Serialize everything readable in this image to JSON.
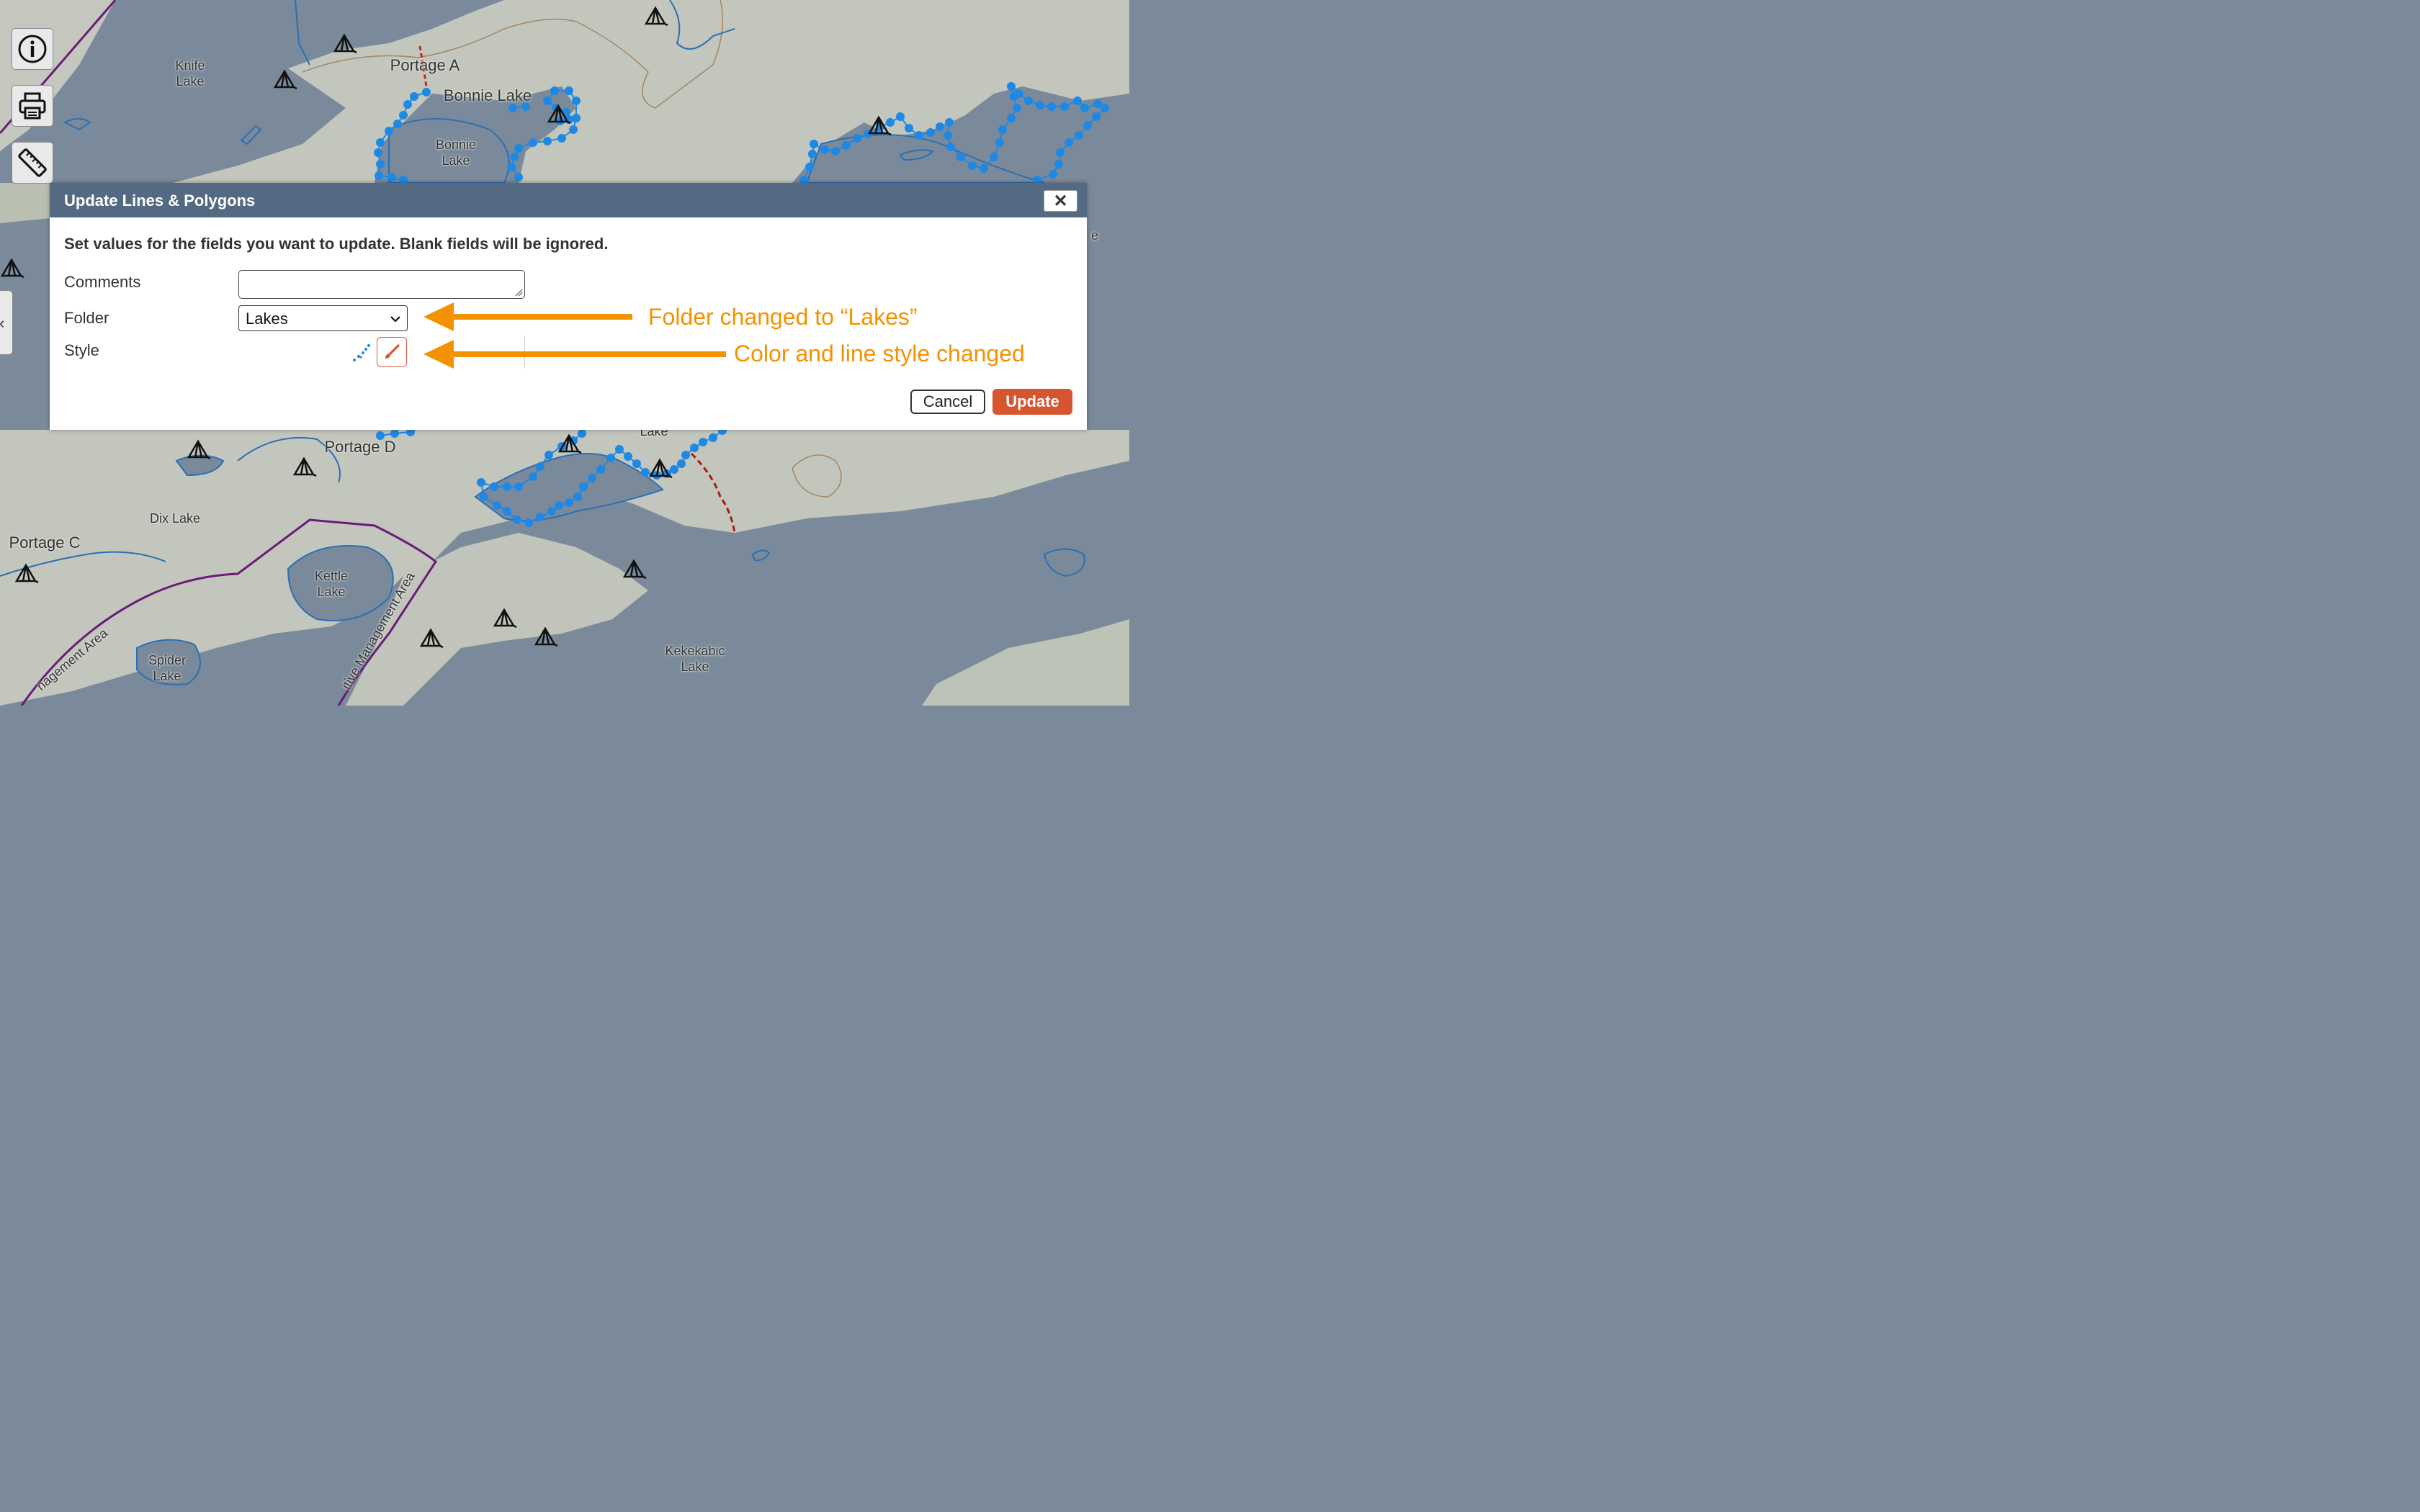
{
  "map": {
    "labels": {
      "knife_lake": "Knife\nLake",
      "portage_a": "Portage A",
      "bonnie_lake_point": "Bonnie Lake",
      "bonnie_lake": "Bonnie\nLake",
      "portage_d": "Portage D",
      "dix_lake": "Dix Lake",
      "portage_c": "Portage C",
      "kettle_lake": "Kettle\nLake",
      "spider_lake": "Spider\nLake",
      "kekekabic_lake": "Kekekabic\nLake",
      "lake_partial": "Lake",
      "e_partial": "e",
      "management_area_left": "nagement Area",
      "management_area_right": "itive Management Area"
    },
    "colors": {
      "water": "#7b8a9a",
      "land": "#c2c6bc",
      "route": "#1e88e5",
      "boundary": "#6a1b78",
      "portage": "#c62828"
    }
  },
  "toolbar": {
    "info_icon": "info-icon",
    "print_icon": "printer-icon",
    "measure_icon": "ruler-icon",
    "side_tab": "‹"
  },
  "dialog": {
    "title": "Update Lines & Polygons",
    "close_label": "✕",
    "instructions": "Set values for the fields you want to update. Blank fields will be ignored.",
    "fields": {
      "comments_label": "Comments",
      "comments_value": "",
      "folder_label": "Folder",
      "folder_value": "Lakes",
      "style_label": "Style"
    },
    "buttons": {
      "cancel": "Cancel",
      "update": "Update"
    },
    "colors": {
      "header": "#546a82",
      "update": "#d4552f",
      "style_color": "#1e88e5"
    }
  },
  "annotations": {
    "folder_note": "Folder changed to “Lakes”",
    "style_note": "Color and line style changed",
    "color": "#f39200"
  }
}
